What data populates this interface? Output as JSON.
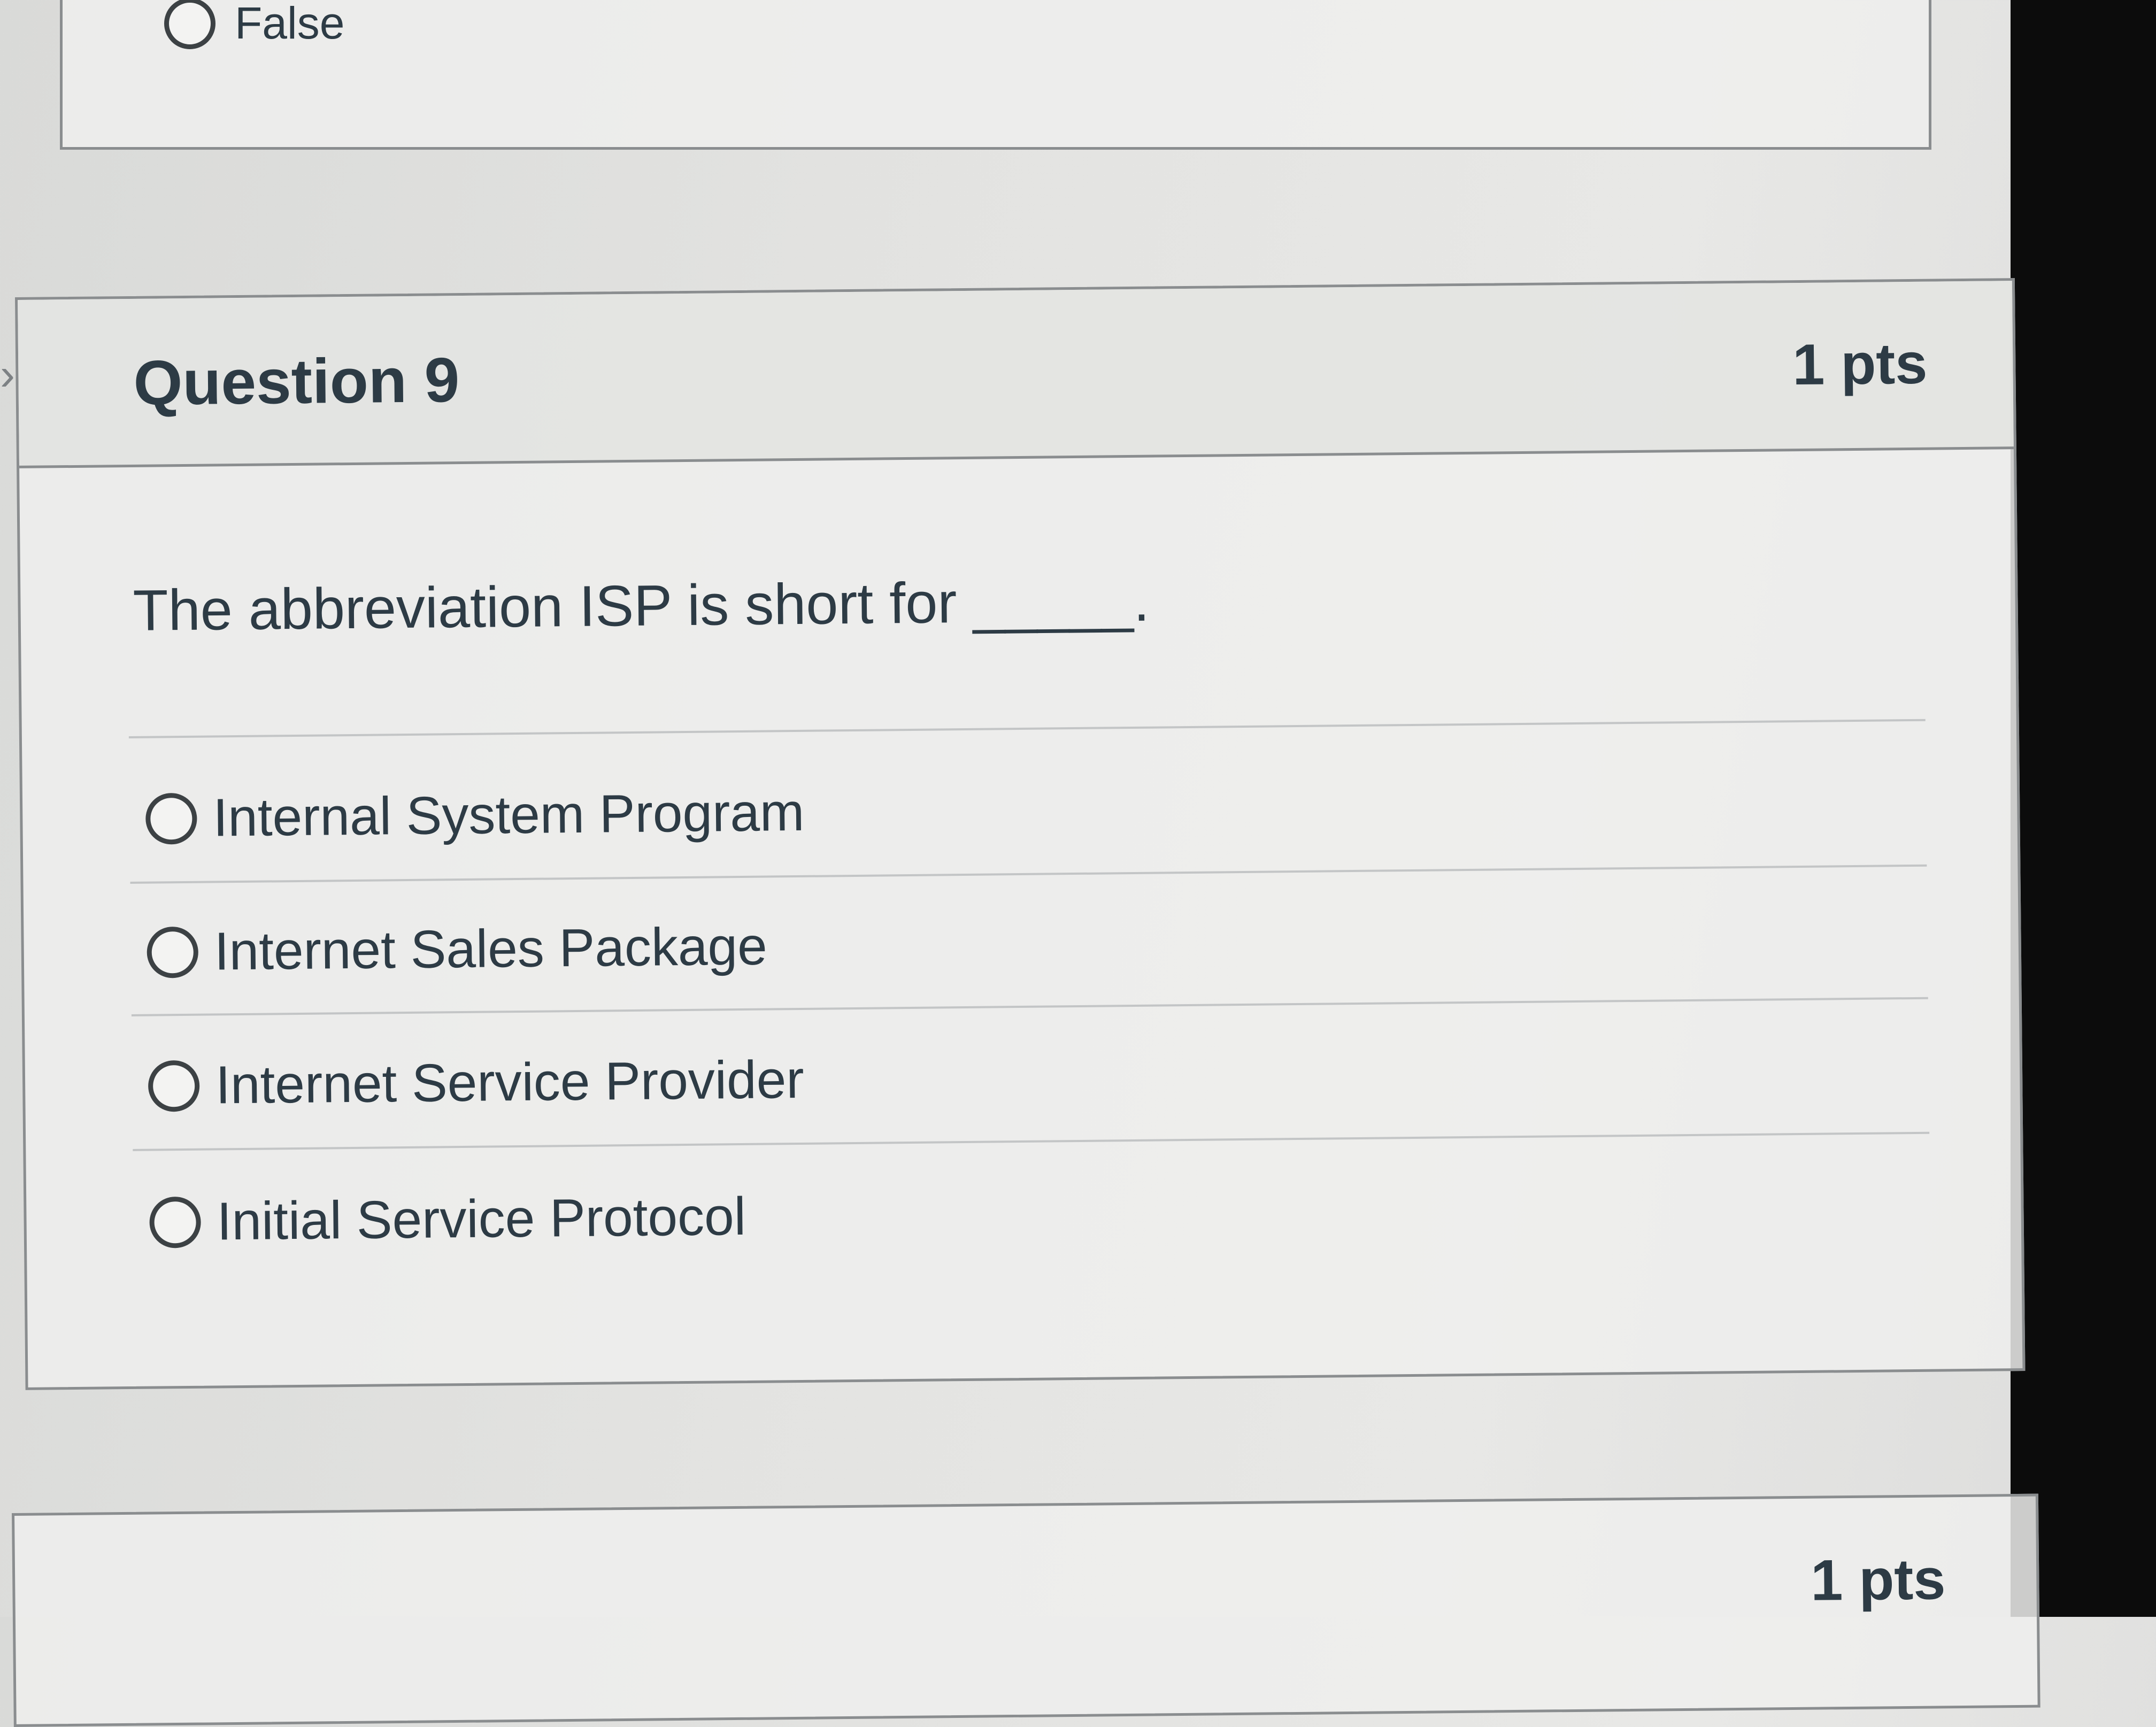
{
  "previous_question": {
    "option_label": "False"
  },
  "question": {
    "title": "Question 9",
    "points": "1 pts",
    "text": "The abbreviation ISP is short for _____.",
    "answers": [
      {
        "label": "Internal System Program",
        "selected": false
      },
      {
        "label": "Internet Sales Package",
        "selected": false
      },
      {
        "label": "Internet Service Provider",
        "selected": false
      },
      {
        "label": "Initial Service Protocol",
        "selected": false
      }
    ]
  },
  "next_question": {
    "points": "1 pts"
  },
  "icons": {
    "collapse": "chevron-right-icon",
    "radio": "radio-unselected-icon"
  },
  "colors": {
    "text": "#2d3b45",
    "border": "#8a8d8f",
    "divider": "#c3c5c6"
  }
}
